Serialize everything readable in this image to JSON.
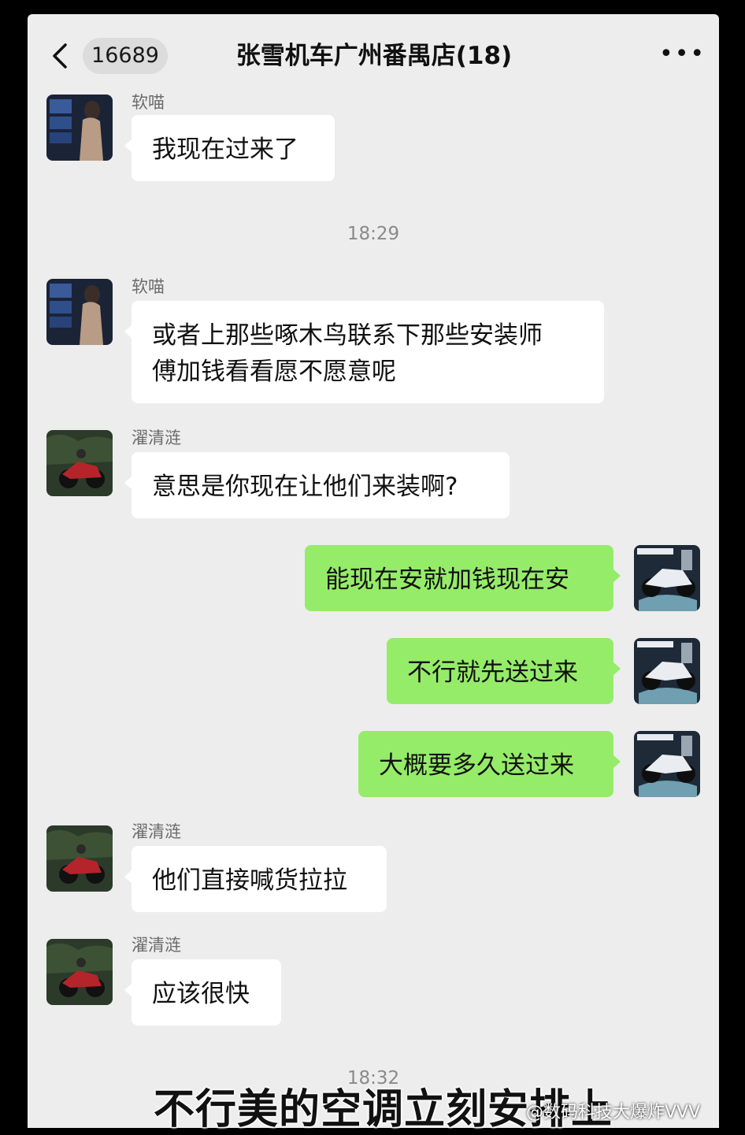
{
  "header": {
    "unread_count": "16689",
    "title": "张雪机车广州番禺店(18)",
    "more_label": "•••"
  },
  "messages": [
    {
      "type": "text",
      "side": "other",
      "sender": "软喵",
      "text": "我现在过来了"
    },
    {
      "type": "time",
      "text": "18:29"
    },
    {
      "type": "text",
      "side": "other",
      "sender": "软喵",
      "lines": [
        "或者上那些啄木鸟联系下那些安装师",
        "傅加钱看看愿不愿意呢"
      ]
    },
    {
      "type": "text",
      "side": "other",
      "sender": "濯清涟",
      "text": "意思是你现在让他们来装啊?"
    },
    {
      "type": "text",
      "side": "me",
      "text": "能现在安就加钱现在安"
    },
    {
      "type": "text",
      "side": "me",
      "text": "不行就先送过来"
    },
    {
      "type": "text",
      "side": "me",
      "text": "大概要多久送过来"
    },
    {
      "type": "text",
      "side": "other",
      "sender": "濯清涟",
      "text": "他们直接喊货拉拉"
    },
    {
      "type": "text",
      "side": "other",
      "sender": "濯清涟",
      "text": "应该很快"
    },
    {
      "type": "time",
      "text": "18:32"
    }
  ],
  "overlay": {
    "subtitle": "不行美的空调立刻安排上",
    "watermark": "@数码科技大爆炸VVV"
  },
  "colors": {
    "chat_bg": "#ededed",
    "bubble_other": "#ffffff",
    "bubble_me": "#95ec69"
  },
  "icons": [
    "back-chevron-icon",
    "more-icon"
  ]
}
